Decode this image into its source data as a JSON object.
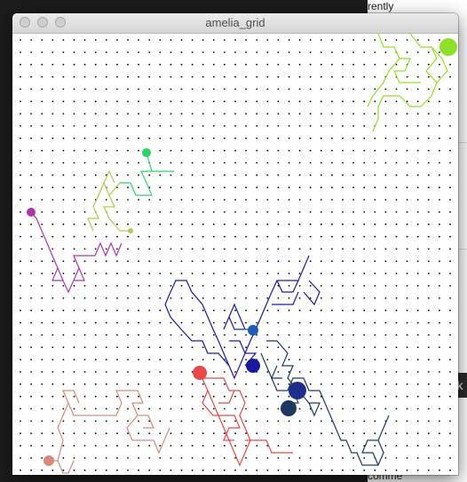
{
  "window": {
    "title": "amelia_grid",
    "buttons": [
      "close",
      "minimize",
      "zoom"
    ]
  },
  "background_window": {
    "visible_text": [
      "rently",
      "ow",
      "r s",
      "comme"
    ],
    "dark_button_glyph": "k"
  },
  "canvas": {
    "background": "#ffffff",
    "dot_color": "#000000",
    "walkers": [
      {
        "name": "lime-walker",
        "color": "#8fe02a"
      },
      {
        "name": "green-walker",
        "color": "#2ed36b"
      },
      {
        "name": "olive-walker",
        "color": "#b3c94a"
      },
      {
        "name": "magenta-walker",
        "color": "#b033b0"
      },
      {
        "name": "navy-walker",
        "color": "#1a1aa0"
      },
      {
        "name": "blue-walker",
        "color": "#1f5bb5"
      },
      {
        "name": "steel-walker",
        "color": "#1d3a5e"
      },
      {
        "name": "red-walker",
        "color": "#e84848"
      },
      {
        "name": "salmon-walker",
        "color": "#d98a7a"
      },
      {
        "name": "darkblue-walker",
        "color": "#1c2f8a"
      }
    ]
  }
}
